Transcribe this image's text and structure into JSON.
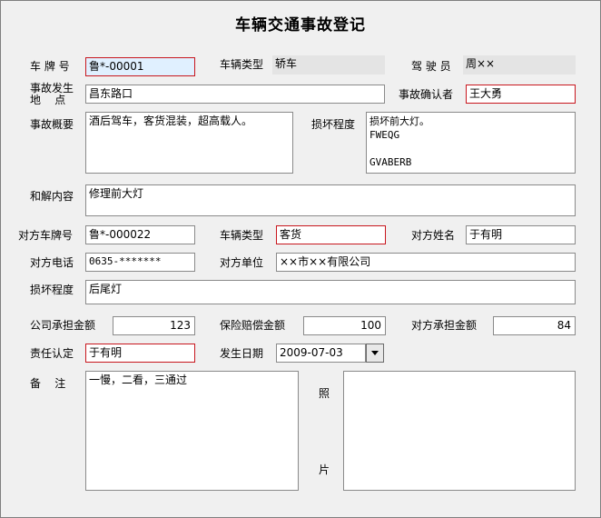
{
  "title": "车辆交通事故登记",
  "fields": {
    "plate_label": "车 牌 号",
    "plate_value": "鲁*-00001",
    "vehicle_type_label": "车辆类型",
    "vehicle_type_value": "轿车",
    "driver_label": "驾 驶 员",
    "driver_value": "周××",
    "location_label_1": "事故发生",
    "location_label_2": "地    点",
    "location_value": "昌东路口",
    "confirmer_label": "事故确认者",
    "confirmer_value": "王大勇",
    "summary_label": "事故概要",
    "summary_value": "酒后驾车，客货混装，超高载人。",
    "damage_label": "损坏程度",
    "damage_value": "损坏前大灯。\nFWEQG\n\nGVABERB",
    "settlement_label": "和解内容",
    "settlement_value": "修理前大灯",
    "other_plate_label": "对方车牌号",
    "other_plate_value": "鲁*-000022",
    "other_type_label": "车辆类型",
    "other_type_value": "客货",
    "other_name_label": "对方姓名",
    "other_name_value": "于有明",
    "other_phone_label": "对方电话",
    "other_phone_value": "0635-*******",
    "other_unit_label": "对方单位",
    "other_unit_value": "××市××有限公司",
    "other_damage_label": "损坏程度",
    "other_damage_value": "后尾灯",
    "company_amount_label": "公司承担金额",
    "company_amount_value": "123",
    "insurance_amount_label": "保险赔偿金额",
    "insurance_amount_value": "100",
    "other_amount_label": "对方承担金额",
    "other_amount_value": "84",
    "responsibility_label": "责任认定",
    "responsibility_value": "于有明",
    "date_label": "发生日期",
    "date_value": "2009-07-03",
    "remark_label": "备    注",
    "remark_value": "一慢，二看，三通过",
    "photo_label_1": "照",
    "photo_label_2": "片"
  },
  "icons": {
    "date_dropdown": "chevron-down-icon"
  },
  "colors": {
    "required_border": "#c8161d",
    "focus_background": "#e0f0ff",
    "readonly_background": "#e4e4e4"
  }
}
